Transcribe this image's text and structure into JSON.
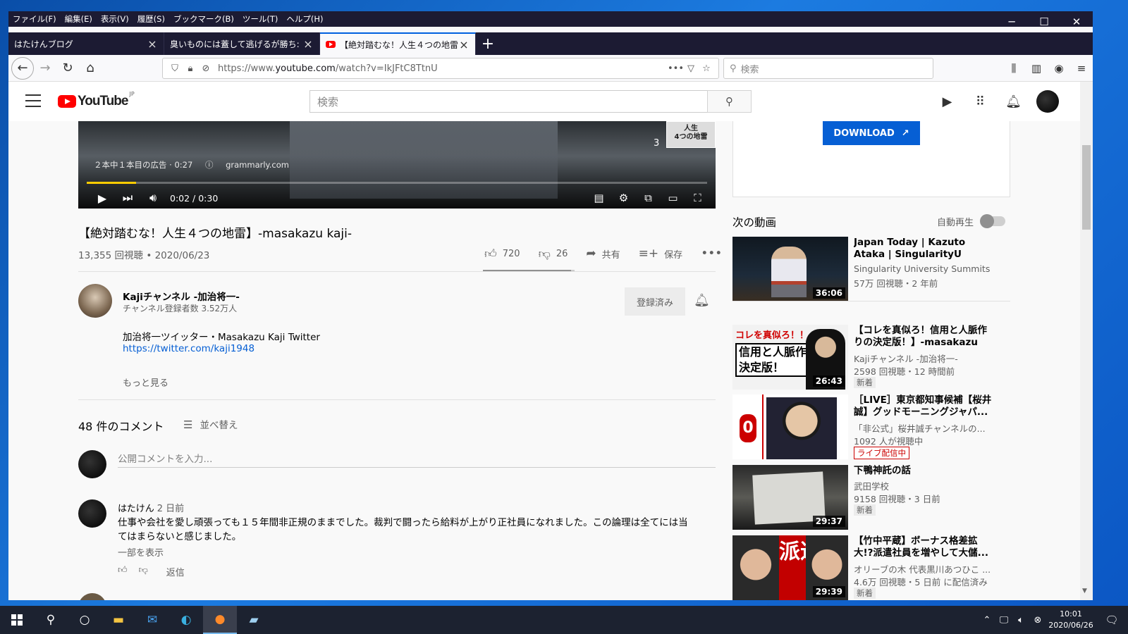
{
  "browser": {
    "menu": [
      "ファイル(F)",
      "編集(E)",
      "表示(V)",
      "履歴(S)",
      "ブックマーク(B)",
      "ツール(T)",
      "ヘルプ(H)"
    ],
    "tabs": [
      {
        "title": "はたけんブログ"
      },
      {
        "title": "臭いものには蓋して逃げるが勝ち: はたけ"
      },
      {
        "title": "【絶対踏むな！人生４つの地雷】-"
      }
    ],
    "url_prefix": "https://www.",
    "url_domain": "youtube.com",
    "url_path": "/watch?v=IkJFtC8TtnU",
    "search_placeholder": "検索"
  },
  "youtube": {
    "logo_text": "YouTube",
    "logo_region": "JP",
    "search_placeholder": "検索"
  },
  "player": {
    "ad_text": "２本中１本目の広告 · 0:27",
    "ad_domain": "grammarly.com",
    "ad_count": "3",
    "thumb_text": "人生\n4つの地雷",
    "time": "0:02 / 0:30",
    "progress": 0.08
  },
  "video": {
    "title": "【絶対踏むな！人生４つの地雷】-masakazu kaji-",
    "meta": "13,355 回視聴 • 2020/06/23",
    "likes": "720",
    "dislikes": "26",
    "share": "共有",
    "save": "保存",
    "like_ratio": 0.96
  },
  "channel": {
    "name": "Kajiチャンネル -加治将一-",
    "subs": "チャンネル登録者数 3.52万人",
    "subscribed": "登録済み",
    "desc_line1": "加治将一ツイッター・Masakazu Kaji Twitter",
    "desc_link": "https://twitter.com/kaji1948",
    "show_more": "もっと見る"
  },
  "comments": {
    "count": "48 件のコメント",
    "sort": "並べ替え",
    "placeholder": "公開コメントを入力...",
    "items": [
      {
        "author": "はたけん",
        "time": "2 日前",
        "text": "仕事や会社を愛し頑張っても１５年間非正規のままでした。裁判で闘ったら給料が上がり正社員になれました。この論理は全てには当てはまらないと感じました。",
        "more": "一部を表示",
        "reply": "返信"
      }
    ]
  },
  "sidebar": {
    "ad_button": "DOWNLOAD",
    "up_next": "次の動画",
    "autoplay": "自動再生",
    "videos": [
      {
        "title": "Japan Today | Kazuto Ataka | SingularityU Japan Summit",
        "channel": "Singularity University Summits",
        "stats": "57万 回視聴・2 年前",
        "duration": "36:06",
        "badge": ""
      },
      {
        "title": "【コレを真似ろ！信用と人脈作りの決定版！】-masakazu kaji-",
        "channel": "Kajiチャンネル -加治将一-",
        "stats": "2598 回視聴・12 時間前",
        "duration": "26:43",
        "badge": "新着"
      },
      {
        "title": "［LIVE］東京都知事候補【桜井誠】グッドモーニングジャパ...",
        "channel": "「非公式」桜井誠チャンネルの...",
        "stats": "1092 人が視聴中",
        "duration": "",
        "badge": "ライブ配信中"
      },
      {
        "title": "下鴨神託の話",
        "channel": "武田学校",
        "stats": "9158 回視聴・3 日前",
        "duration": "29:37",
        "badge": "新着"
      },
      {
        "title": "【竹中平蔵】ボーナス格差拡大!?派遣社員を増やして大儲...",
        "channel": "オリーブの木 代表黒川あつひこ ...",
        "stats": "4.6万 回視聴・5 日前 に配信済み",
        "duration": "29:39",
        "badge": "新着"
      }
    ],
    "thumb_texts": {
      "t2_top": "コレを真似ろ！！",
      "t2_main": "信用と人脈作り\n決定版！",
      "t3_zero": "0",
      "t5_char": "派遣"
    }
  },
  "taskbar": {
    "time": "10:01",
    "date": "2020/06/26"
  }
}
